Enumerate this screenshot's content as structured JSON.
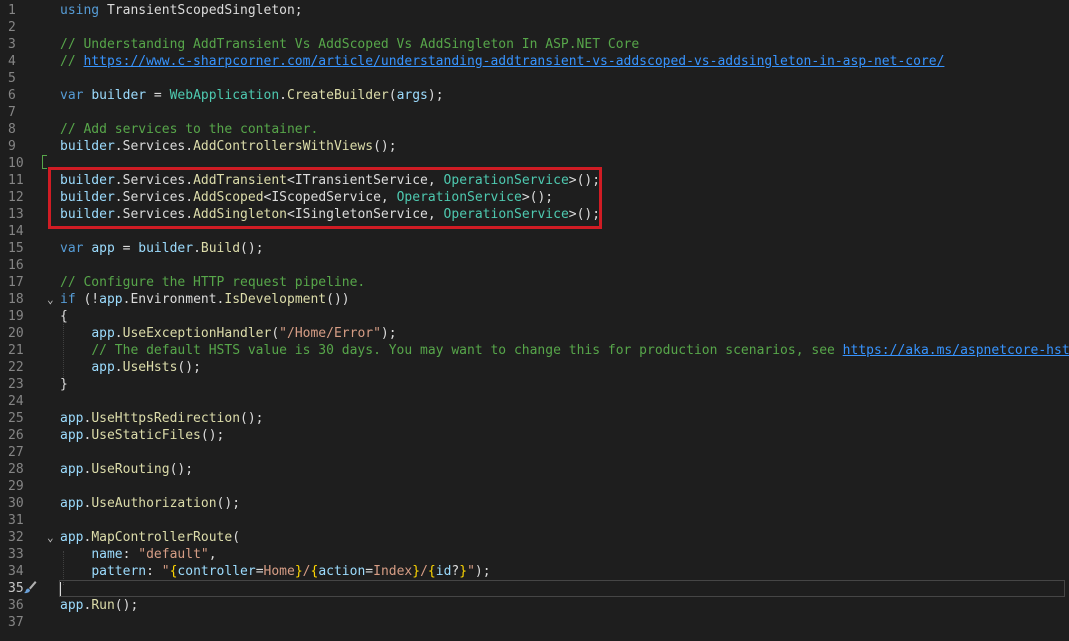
{
  "editor": {
    "lines": [
      {
        "n": "1",
        "tokens": [
          [
            "kw",
            "using"
          ],
          [
            "pl",
            " TransientScopedSingleton;"
          ]
        ]
      },
      {
        "n": "2",
        "tokens": []
      },
      {
        "n": "3",
        "tokens": [
          [
            "cm",
            "// Understanding AddTransient Vs AddScoped Vs AddSingleton In ASP.NET Core"
          ]
        ]
      },
      {
        "n": "4",
        "tokens": [
          [
            "cm",
            "// "
          ],
          [
            "lk",
            "https://www.c-sharpcorner.com/article/understanding-addtransient-vs-addscoped-vs-addsingleton-in-asp-net-core/"
          ]
        ]
      },
      {
        "n": "5",
        "tokens": []
      },
      {
        "n": "6",
        "tokens": [
          [
            "kw",
            "var"
          ],
          [
            "pl",
            " "
          ],
          [
            "vr",
            "builder"
          ],
          [
            "pl",
            " = "
          ],
          [
            "ty",
            "WebApplication"
          ],
          [
            "pl",
            "."
          ],
          [
            "fn",
            "CreateBuilder"
          ],
          [
            "pl",
            "("
          ],
          [
            "vr",
            "args"
          ],
          [
            "pl",
            ");"
          ]
        ]
      },
      {
        "n": "7",
        "tokens": []
      },
      {
        "n": "8",
        "tokens": [
          [
            "cm",
            "// Add services to the container."
          ]
        ]
      },
      {
        "n": "9",
        "tokens": [
          [
            "vr",
            "builder"
          ],
          [
            "pl",
            ".Services."
          ],
          [
            "fn",
            "AddControllersWithViews"
          ],
          [
            "pl",
            "();"
          ]
        ]
      },
      {
        "n": "10",
        "tokens": []
      },
      {
        "n": "11",
        "tokens": [
          [
            "vr",
            "builder"
          ],
          [
            "pl",
            ".Services."
          ],
          [
            "fn",
            "AddTransient"
          ],
          [
            "pl",
            "<ITransientService, "
          ],
          [
            "ty",
            "OperationService"
          ],
          [
            "pl",
            ">();"
          ]
        ]
      },
      {
        "n": "12",
        "tokens": [
          [
            "vr",
            "builder"
          ],
          [
            "pl",
            ".Services."
          ],
          [
            "fn",
            "AddScoped"
          ],
          [
            "pl",
            "<IScopedService, "
          ],
          [
            "ty",
            "OperationService"
          ],
          [
            "pl",
            ">();"
          ]
        ]
      },
      {
        "n": "13",
        "tokens": [
          [
            "vr",
            "builder"
          ],
          [
            "pl",
            ".Services."
          ],
          [
            "fn",
            "AddSingleton"
          ],
          [
            "pl",
            "<ISingletonService, "
          ],
          [
            "ty",
            "OperationService"
          ],
          [
            "pl",
            ">();"
          ]
        ]
      },
      {
        "n": "14",
        "tokens": []
      },
      {
        "n": "15",
        "tokens": [
          [
            "kw",
            "var"
          ],
          [
            "pl",
            " "
          ],
          [
            "vr",
            "app"
          ],
          [
            "pl",
            " = "
          ],
          [
            "vr",
            "builder"
          ],
          [
            "pl",
            "."
          ],
          [
            "fn",
            "Build"
          ],
          [
            "pl",
            "();"
          ]
        ]
      },
      {
        "n": "16",
        "tokens": []
      },
      {
        "n": "17",
        "tokens": [
          [
            "cm",
            "// Configure the HTTP request pipeline."
          ]
        ]
      },
      {
        "n": "18",
        "fold": "⌄",
        "tokens": [
          [
            "kw",
            "if"
          ],
          [
            "pl",
            " (!"
          ],
          [
            "vr",
            "app"
          ],
          [
            "pl",
            ".Environment."
          ],
          [
            "fn",
            "IsDevelopment"
          ],
          [
            "pl",
            "())"
          ]
        ]
      },
      {
        "n": "19",
        "tokens": [
          [
            "pl",
            "{"
          ]
        ]
      },
      {
        "n": "20",
        "tokens": [
          [
            "pl",
            "    "
          ],
          [
            "vr",
            "app"
          ],
          [
            "pl",
            "."
          ],
          [
            "fn",
            "UseExceptionHandler"
          ],
          [
            "pl",
            "("
          ],
          [
            "st",
            "\"/Home/Error\""
          ],
          [
            "pl",
            ");"
          ]
        ]
      },
      {
        "n": "21",
        "tokens": [
          [
            "pl",
            "    "
          ],
          [
            "cm",
            "// The default HSTS value is 30 days. You may want to change this for production scenarios, see "
          ],
          [
            "lk",
            "https://aka.ms/aspnetcore-hsts"
          ],
          [
            "cm",
            "."
          ]
        ]
      },
      {
        "n": "22",
        "tokens": [
          [
            "pl",
            "    "
          ],
          [
            "vr",
            "app"
          ],
          [
            "pl",
            "."
          ],
          [
            "fn",
            "UseHsts"
          ],
          [
            "pl",
            "();"
          ]
        ]
      },
      {
        "n": "23",
        "tokens": [
          [
            "pl",
            "}"
          ]
        ]
      },
      {
        "n": "24",
        "tokens": []
      },
      {
        "n": "25",
        "tokens": [
          [
            "vr",
            "app"
          ],
          [
            "pl",
            "."
          ],
          [
            "fn",
            "UseHttpsRedirection"
          ],
          [
            "pl",
            "();"
          ]
        ]
      },
      {
        "n": "26",
        "tokens": [
          [
            "vr",
            "app"
          ],
          [
            "pl",
            "."
          ],
          [
            "fn",
            "UseStaticFiles"
          ],
          [
            "pl",
            "();"
          ]
        ]
      },
      {
        "n": "27",
        "tokens": []
      },
      {
        "n": "28",
        "tokens": [
          [
            "vr",
            "app"
          ],
          [
            "pl",
            "."
          ],
          [
            "fn",
            "UseRouting"
          ],
          [
            "pl",
            "();"
          ]
        ]
      },
      {
        "n": "29",
        "tokens": []
      },
      {
        "n": "30",
        "tokens": [
          [
            "vr",
            "app"
          ],
          [
            "pl",
            "."
          ],
          [
            "fn",
            "UseAuthorization"
          ],
          [
            "pl",
            "();"
          ]
        ]
      },
      {
        "n": "31",
        "tokens": []
      },
      {
        "n": "32",
        "fold": "⌄",
        "tokens": [
          [
            "vr",
            "app"
          ],
          [
            "pl",
            "."
          ],
          [
            "fn",
            "MapControllerRoute"
          ],
          [
            "pl",
            "("
          ]
        ]
      },
      {
        "n": "33",
        "tokens": [
          [
            "pl",
            "    "
          ],
          [
            "vr",
            "name"
          ],
          [
            "pl",
            ": "
          ],
          [
            "st",
            "\"default\""
          ],
          [
            "pl",
            ","
          ]
        ]
      },
      {
        "n": "34",
        "tokens": [
          [
            "pl",
            "    "
          ],
          [
            "vr",
            "pattern"
          ],
          [
            "pl",
            ": "
          ],
          [
            "st",
            "\""
          ],
          [
            "br",
            "{"
          ],
          [
            "vr",
            "controller"
          ],
          [
            "pl",
            "="
          ],
          [
            "st",
            "Home"
          ],
          [
            "br",
            "}"
          ],
          [
            "st",
            "/"
          ],
          [
            "br",
            "{"
          ],
          [
            "vr",
            "action"
          ],
          [
            "pl",
            "="
          ],
          [
            "st",
            "Index"
          ],
          [
            "br",
            "}"
          ],
          [
            "st",
            "/"
          ],
          [
            "br",
            "{"
          ],
          [
            "vr",
            "id"
          ],
          [
            "pl",
            "?"
          ],
          [
            "br",
            "}"
          ],
          [
            "st",
            "\""
          ],
          [
            "pl",
            ");"
          ]
        ]
      },
      {
        "n": "35",
        "active": true,
        "tokens": []
      },
      {
        "n": "36",
        "tokens": [
          [
            "vr",
            "app"
          ],
          [
            "pl",
            "."
          ],
          [
            "fn",
            "Run"
          ],
          [
            "pl",
            "();"
          ]
        ]
      },
      {
        "n": "37",
        "tokens": []
      }
    ]
  },
  "icons": {
    "quick_action": "paintbrush-icon",
    "fold": "chevron-down-icon"
  },
  "colors": {
    "background": "#1e1e1e",
    "highlight_box": "#d01c24"
  }
}
